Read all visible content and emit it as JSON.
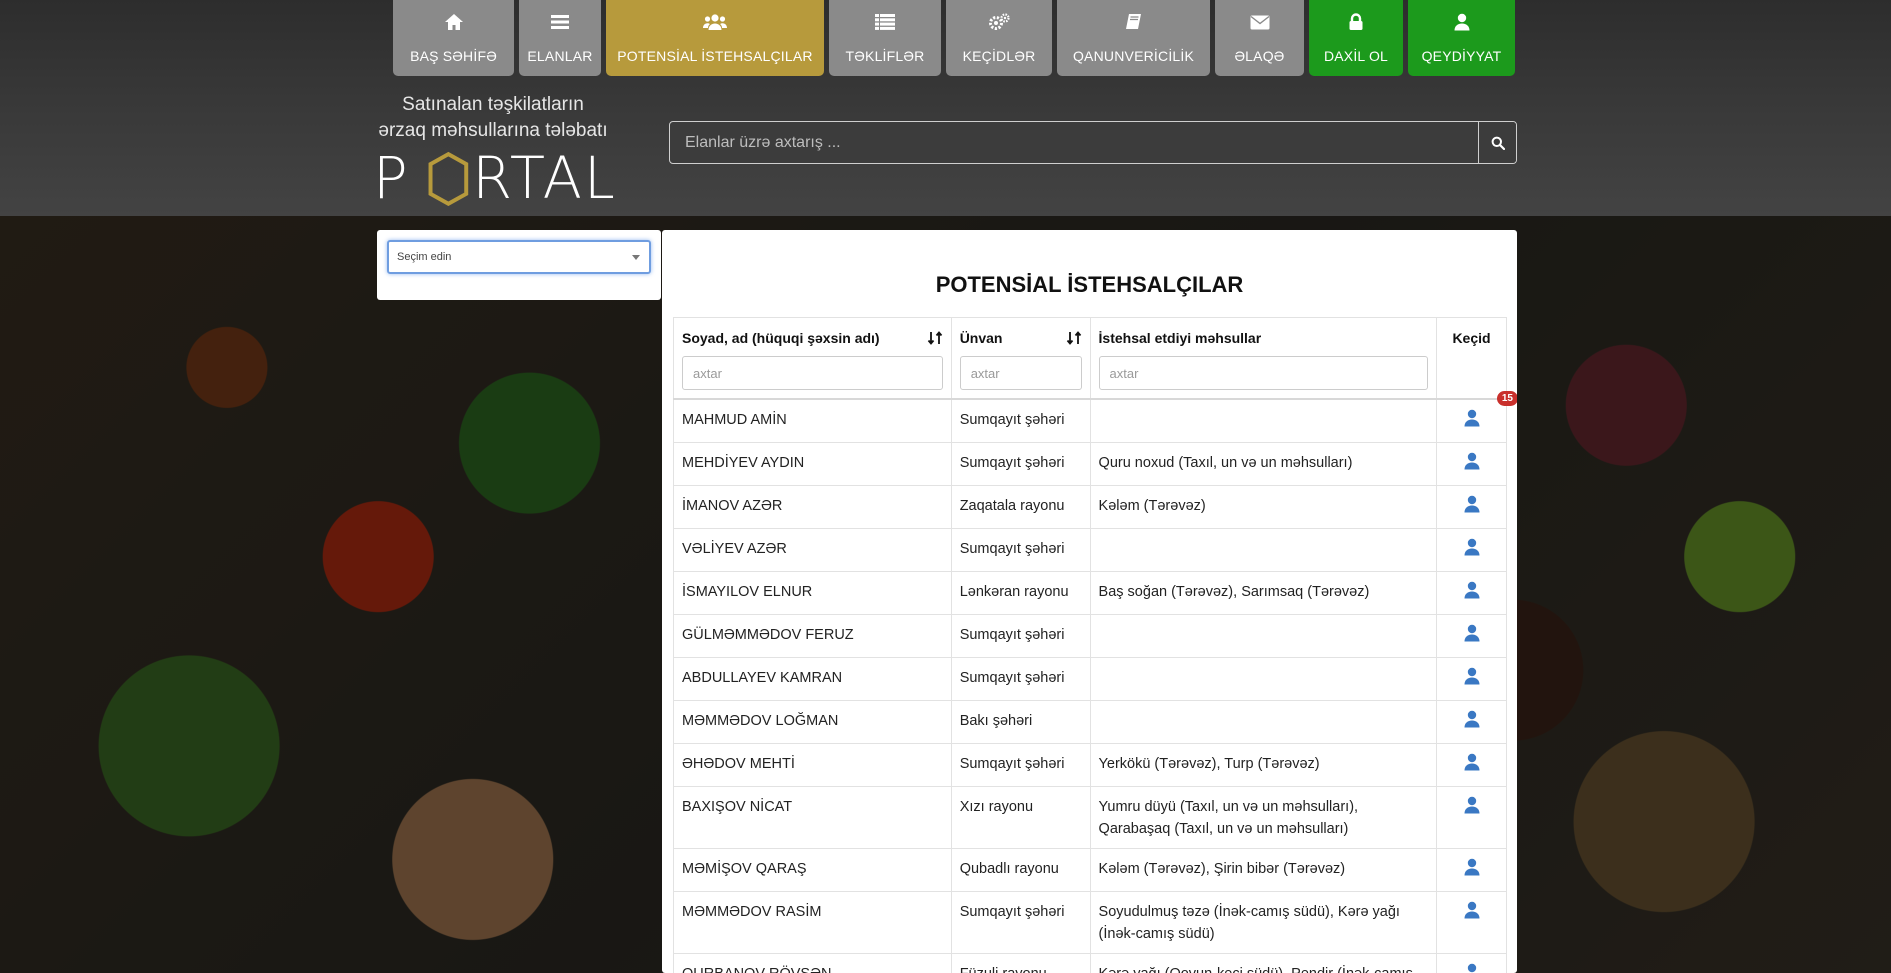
{
  "nav": {
    "items": [
      {
        "label": "BAŞ SƏHİFƏ",
        "icon": "home-icon"
      },
      {
        "label": "ELANLAR",
        "icon": "list-icon"
      },
      {
        "label": "POTENSİAL İSTEHSALÇILAR",
        "icon": "users-icon"
      },
      {
        "label": "TƏKLİFLƏR",
        "icon": "table-list-icon"
      },
      {
        "label": "KEÇİDLƏR",
        "icon": "gears-icon"
      },
      {
        "label": "QANUNVERİCİLİK",
        "icon": "book-icon"
      },
      {
        "label": "ƏLAQƏ",
        "icon": "envelope-icon"
      },
      {
        "label": "DAXİL OL",
        "icon": "lock-icon"
      },
      {
        "label": "QEYDİYYAT",
        "icon": "user-icon"
      }
    ],
    "active_index": 2,
    "colors": {
      "default": "#8a8a8a",
      "active": "#b79a3c",
      "auth": "#1c9a1c"
    }
  },
  "logo": {
    "line1": "Satınalan təşkilatların",
    "line2": "ərzaq məhsullarına tələbatı",
    "word": "PORTALI"
  },
  "search": {
    "placeholder": "Elanlar üzrə axtarış ...",
    "button_icon": "search-icon"
  },
  "filter": {
    "select_value": "Seçim edin"
  },
  "main": {
    "title": "POTENSİAL İSTEHSALÇILAR",
    "columns": {
      "name": "Soyad, ad (hüquqi şəxsin adı)",
      "address": "Ünvan",
      "products": "İstehsal etdiyi məhsullar",
      "link": "Keçid"
    },
    "filter_placeholder": "axtar",
    "badge_count": "15",
    "rows": [
      {
        "name": "MAHMUD AMİN",
        "address": "Sumqayıt şəhəri",
        "products": ""
      },
      {
        "name": "MEHDİYEV AYDIN",
        "address": "Sumqayıt şəhəri",
        "products": "Quru noxud (Taxıl, un və un məhsulları)"
      },
      {
        "name": "İMANOV AZƏR",
        "address": "Zaqatala rayonu",
        "products": "Kələm (Tərəvəz)"
      },
      {
        "name": "VƏLİYEV AZƏR",
        "address": "Sumqayıt şəhəri",
        "products": ""
      },
      {
        "name": "İSMAYILOV ELNUR",
        "address": "Lənkəran rayonu",
        "products": "Baş soğan (Tərəvəz), Sarımsaq (Tərəvəz)"
      },
      {
        "name": "GÜLMƏMMƏDOV FERUZ",
        "address": "Sumqayıt şəhəri",
        "products": ""
      },
      {
        "name": "ABDULLAYEV KAMRAN",
        "address": "Sumqayıt şəhəri",
        "products": ""
      },
      {
        "name": "MƏMMƏDOV LOĞMAN",
        "address": "Bakı şəhəri",
        "products": ""
      },
      {
        "name": "ƏHƏDOV MEHTİ",
        "address": "Sumqayıt şəhəri",
        "products": "Yerkökü (Tərəvəz), Turp (Tərəvəz)"
      },
      {
        "name": "BAXIŞOV NİCAT",
        "address": "Xızı rayonu",
        "products": "Yumru düyü (Taxıl, un və un məhsulları), Qarabaşaq (Taxıl, un və un məhsulları)"
      },
      {
        "name": "MƏMİŞOV QARAŞ",
        "address": "Qubadlı rayonu",
        "products": "Kələm (Tərəvəz), Şirin bibər (Tərəvəz)"
      },
      {
        "name": "MƏMMƏDOV RASİM",
        "address": "Sumqayıt şəhəri",
        "products": "Soyudulmuş təzə (İnək-camış südü), Kərə yağı (İnək-camış südü)"
      },
      {
        "name": "QURBANOV RÖVŞƏN",
        "address": "Füzuli rayonu",
        "products": "Kərə yağı (Qoyun-keçi südü), Pendir (İnək-camış südü)"
      }
    ],
    "link_icon": "user-icon",
    "accent_color": "#3a78c3"
  }
}
